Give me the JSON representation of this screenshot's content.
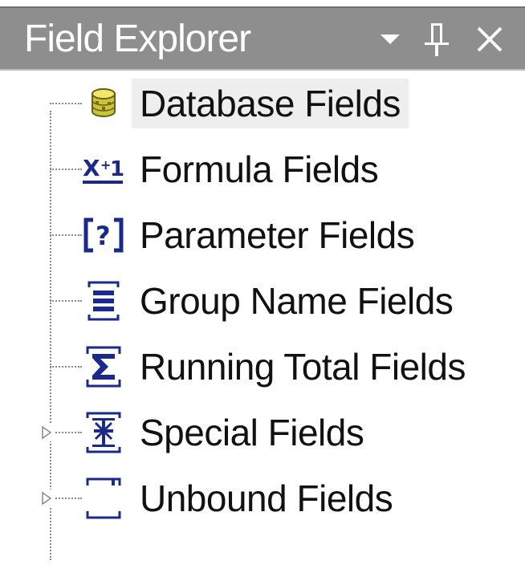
{
  "window": {
    "title": "Field Explorer",
    "buttons": {
      "dropdown_icon": "chevron-down-icon",
      "pin_icon": "pin-icon",
      "close_icon": "close-icon"
    }
  },
  "tree": {
    "items": [
      {
        "label": "Database Fields",
        "icon": "database-icon",
        "expandable": false,
        "selected": true
      },
      {
        "label": "Formula Fields",
        "icon": "formula-icon",
        "expandable": false,
        "selected": false
      },
      {
        "label": "Parameter Fields",
        "icon": "parameter-icon",
        "expandable": false,
        "selected": false
      },
      {
        "label": "Group Name Fields",
        "icon": "group-name-icon",
        "expandable": false,
        "selected": false
      },
      {
        "label": "Running Total Fields",
        "icon": "running-total-icon",
        "expandable": false,
        "selected": false
      },
      {
        "label": "Special Fields",
        "icon": "special-fields-icon",
        "expandable": true,
        "selected": false
      },
      {
        "label": "Unbound Fields",
        "icon": "unbound-fields-icon",
        "expandable": true,
        "selected": false
      }
    ]
  },
  "colors": {
    "title_bar": "#8e8e8e",
    "title_text": "#ffffff",
    "icon_blue": "#1a2a8c",
    "selection": "#eeeeee"
  }
}
